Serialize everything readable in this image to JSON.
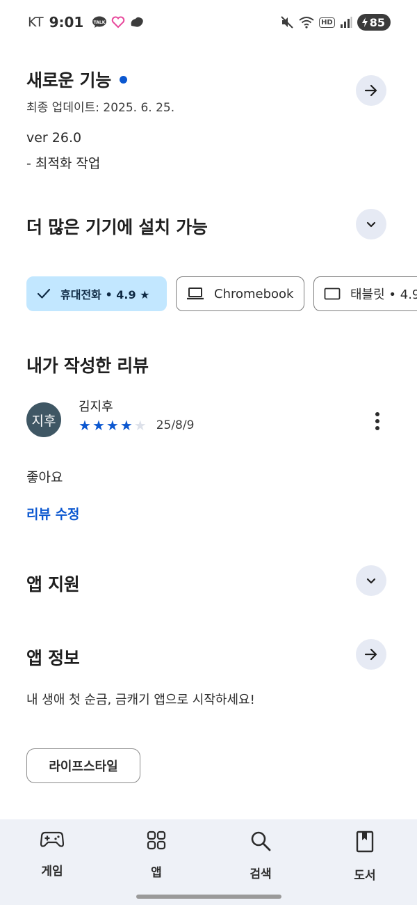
{
  "status_bar": {
    "carrier": "KT",
    "time": "9:01",
    "battery": "85"
  },
  "whats_new": {
    "title": "새로운 기능",
    "updated": "최종 업데이트: 2025. 6. 25.",
    "version": "ver 26.0",
    "note": "- 최적화 작업"
  },
  "devices": {
    "title": "더 많은 기기에 설치 가능",
    "chips": [
      {
        "label": "휴대전화 • 4.9 ★",
        "selected": true
      },
      {
        "label": "Chromebook",
        "selected": false
      },
      {
        "label": "태블릿 • 4.9",
        "selected": false
      }
    ]
  },
  "my_review": {
    "title": "내가 작성한 리뷰",
    "avatar_text": "지후",
    "author": "김지후",
    "rating": 4,
    "max_rating": 5,
    "date": "25/8/9",
    "text": "좋아요",
    "edit_label": "리뷰 수정"
  },
  "app_support": {
    "title": "앱 지원"
  },
  "app_info": {
    "title": "앱 정보",
    "description": "내 생애 첫 순금, 금캐기 앱으로 시작하세요!",
    "category_tag": "라이프스타일"
  },
  "bottom_nav": [
    {
      "label": "게임",
      "icon": "gamepad-icon"
    },
    {
      "label": "앱",
      "icon": "apps-grid-icon"
    },
    {
      "label": "검색",
      "icon": "search-icon"
    },
    {
      "label": "도서",
      "icon": "book-icon"
    }
  ],
  "colors": {
    "accent": "#0b57d0",
    "chip_selected_bg": "#c2e7ff",
    "round_button_bg": "#e6eaf4",
    "nav_bg": "#eef1f7"
  }
}
